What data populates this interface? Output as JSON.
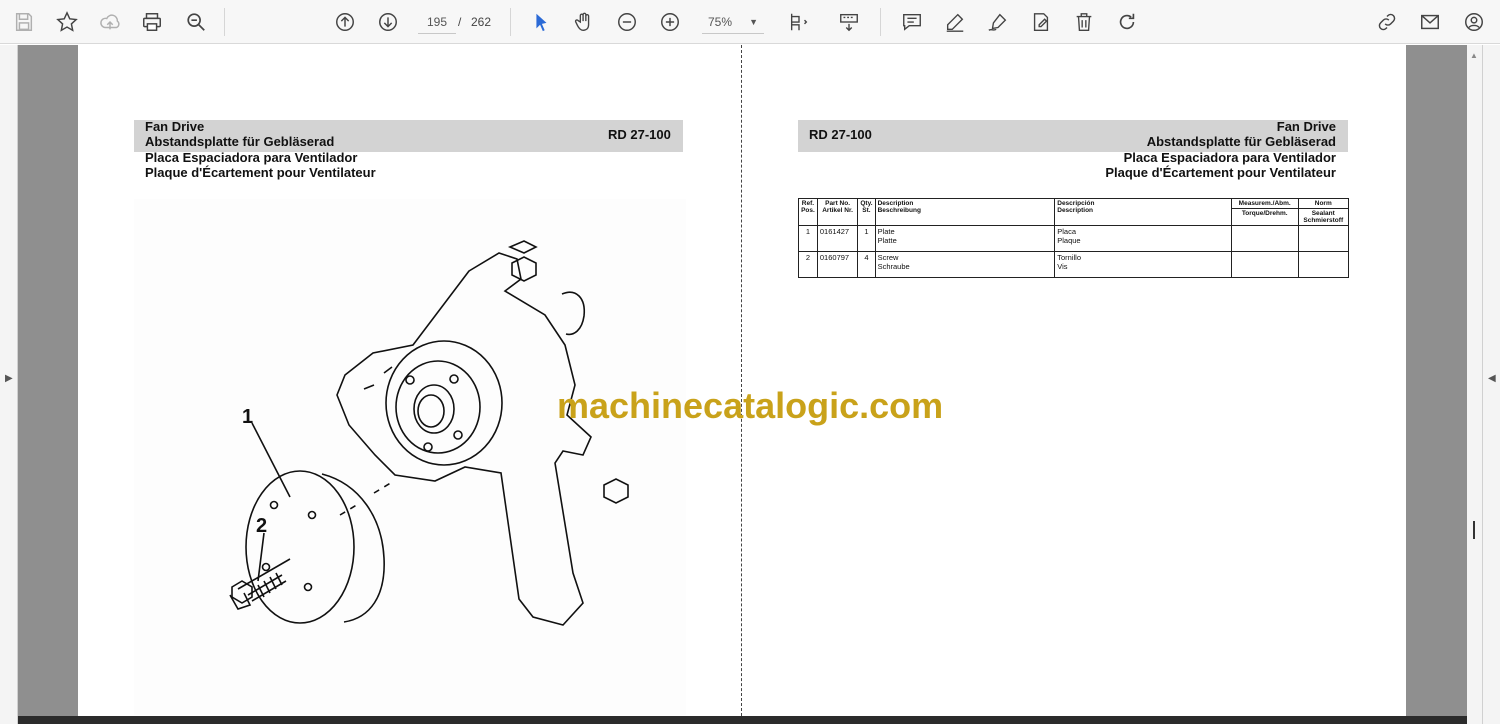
{
  "toolbar": {
    "page_current": "195",
    "page_separator": "/",
    "page_total": "262",
    "zoom": "75%",
    "icons": [
      "save-icon",
      "bookmark-star-icon",
      "upload-cloud-icon",
      "print-icon",
      "zoom-search-icon",
      "page-up-icon",
      "page-down-icon",
      "select-arrow-icon",
      "hand-icon",
      "zoom-out-icon",
      "zoom-in-icon",
      "page-fit-icon",
      "scroll-mode-icon",
      "comment-icon",
      "highlight-pen-icon",
      "sign-pen-icon",
      "fill-sign-icon",
      "delete-icon",
      "rotate-icon",
      "share-link-icon",
      "mail-icon",
      "account-icon"
    ],
    "accent": "#4a4a4a"
  },
  "left_page": {
    "title_en": "Fan Drive",
    "title_de": "Abstandsplatte für Gebläserad",
    "title_es": "Placa Espaciadora para Ventilador",
    "title_fr": "Plaque d'Écartement pour Ventilateur",
    "ref": "RD 27-100",
    "callouts": [
      "1",
      "2"
    ]
  },
  "right_page": {
    "ref": "RD 27-100",
    "title_en": "Fan Drive",
    "title_de": "Abstandsplatte für Gebläserad",
    "title_es": "Placa Espaciadora para Ventilador",
    "title_fr": "Plaque d'Écartement pour Ventilateur",
    "table": {
      "headers": {
        "ref": "Ref. Pos.",
        "part": "Part No. Artikel Nr.",
        "qty": "Qty. St.",
        "desc_en": "Description",
        "desc_de": "Beschreibung",
        "desc_es": "Descripción",
        "desc_fr": "Description",
        "meas": "Measurem./Abm.",
        "torque": "Torque/Drehm.",
        "norm": "Norm",
        "sealant": "Sealant Schmierstoff"
      },
      "rows": [
        {
          "ref": "1",
          "part": "0161427",
          "qty": "1",
          "en": "Plate",
          "de": "Platte",
          "es": "Placa",
          "fr": "Plaque"
        },
        {
          "ref": "2",
          "part": "0160797",
          "qty": "4",
          "en": "Screw",
          "de": "Schraube",
          "es": "Tornillo",
          "fr": "Vis"
        }
      ]
    }
  },
  "watermark": "machinecatalogic.com"
}
